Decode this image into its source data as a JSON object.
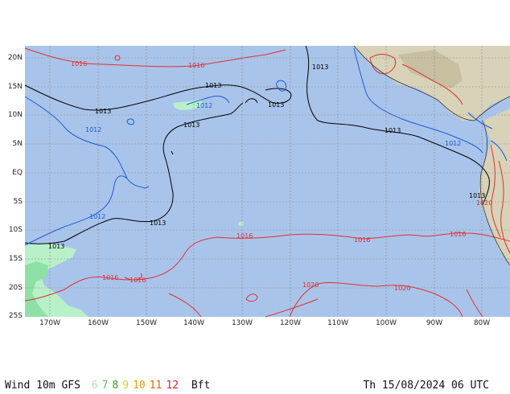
{
  "map": {
    "lat_labels": [
      "20N",
      "15N",
      "10N",
      "5N",
      "EQ",
      "5S",
      "10S",
      "15S",
      "20S",
      "25S"
    ],
    "lon_labels": [
      "170W",
      "160W",
      "150W",
      "140W",
      "130W",
      "120W",
      "110W",
      "100W",
      "90W",
      "80W"
    ],
    "isobars": {
      "red": [
        "1016",
        "1016",
        "1016",
        "1016",
        "1016",
        "1016",
        "1016",
        "1020",
        "1020",
        "1020"
      ],
      "black": [
        "1013",
        "1013",
        "1013",
        "1013",
        "1013",
        "1013",
        "1013",
        "1013",
        "1013"
      ],
      "blue": [
        "1012",
        "1012",
        "1012",
        "1012"
      ]
    },
    "colors": {
      "ocean": "#a9c4ea",
      "land": "#d8d2b8",
      "wind_light": "#b8f0c8",
      "wind_medium": "#6ad48a",
      "isobar_1016_plus": "#e03030",
      "isobar_1013": "#000000",
      "isobar_1012": "#1e5adc",
      "grid": "#8a8a8a"
    }
  },
  "footer": {
    "title": "Wind 10m GFS",
    "legend": [
      {
        "value": "6",
        "color": "#a8e8b0"
      },
      {
        "value": "7",
        "color": "#5cc85c"
      },
      {
        "value": "8",
        "color": "#2e9e2e"
      },
      {
        "value": "9",
        "color": "#e0d020"
      },
      {
        "value": "10",
        "color": "#e8a010"
      },
      {
        "value": "11",
        "color": "#e86010"
      },
      {
        "value": "12",
        "color": "#e02020"
      }
    ],
    "unit": "Bft",
    "datetime": "Th 15/08/2024 06 UTC"
  }
}
